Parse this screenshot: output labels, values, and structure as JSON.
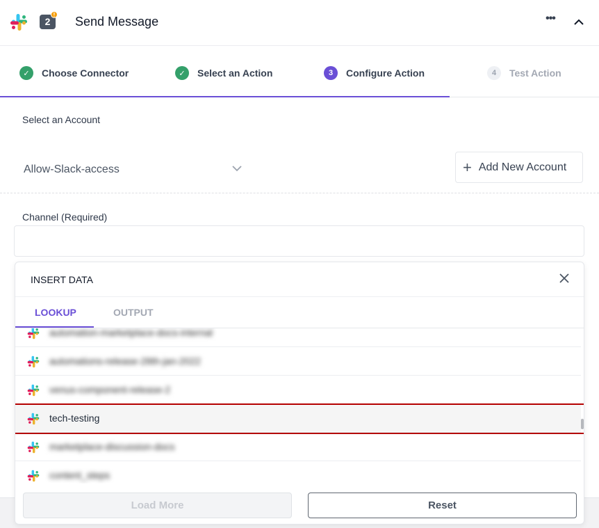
{
  "header": {
    "title": "Send Message",
    "step_number": "2",
    "warning_glyph": "!",
    "more_glyph": "•••",
    "logo": "slack-logo",
    "collapse_icon": "chevron-up-icon"
  },
  "stepper": {
    "steps": [
      {
        "label": "Choose Connector",
        "marker": "✓",
        "state": "done"
      },
      {
        "label": "Select an Action",
        "marker": "✓",
        "state": "done"
      },
      {
        "label": "Configure Action",
        "marker": "3",
        "state": "active"
      },
      {
        "label": "Test Action",
        "marker": "4",
        "state": "todo"
      }
    ]
  },
  "account": {
    "label": "Select an Account",
    "selected": "Allow-Slack-access",
    "add_button": "Add New Account",
    "add_icon": "+"
  },
  "channel": {
    "label": "Channel (Required)",
    "value": ""
  },
  "insert_data": {
    "title": "INSERT DATA",
    "tabs": [
      {
        "label": "LOOKUP",
        "active": true
      },
      {
        "label": "OUTPUT",
        "active": false
      }
    ],
    "items": [
      {
        "label": "automation-marketplace-docs-internal",
        "obscured": true
      },
      {
        "label": "automations-release-28th-jan-2022",
        "obscured": true
      },
      {
        "label": "venus-component-release-2",
        "obscured": true
      },
      {
        "label": "tech-testing",
        "obscured": false,
        "selected": true
      },
      {
        "label": "marketplace-discussion-docs",
        "obscured": true
      },
      {
        "label": "content_steps",
        "obscured": true
      }
    ],
    "load_more": "Load More",
    "reset": "Reset"
  },
  "colors": {
    "accent": "#6a4fd6",
    "done": "#34a06a",
    "highlight": "#b40000"
  }
}
